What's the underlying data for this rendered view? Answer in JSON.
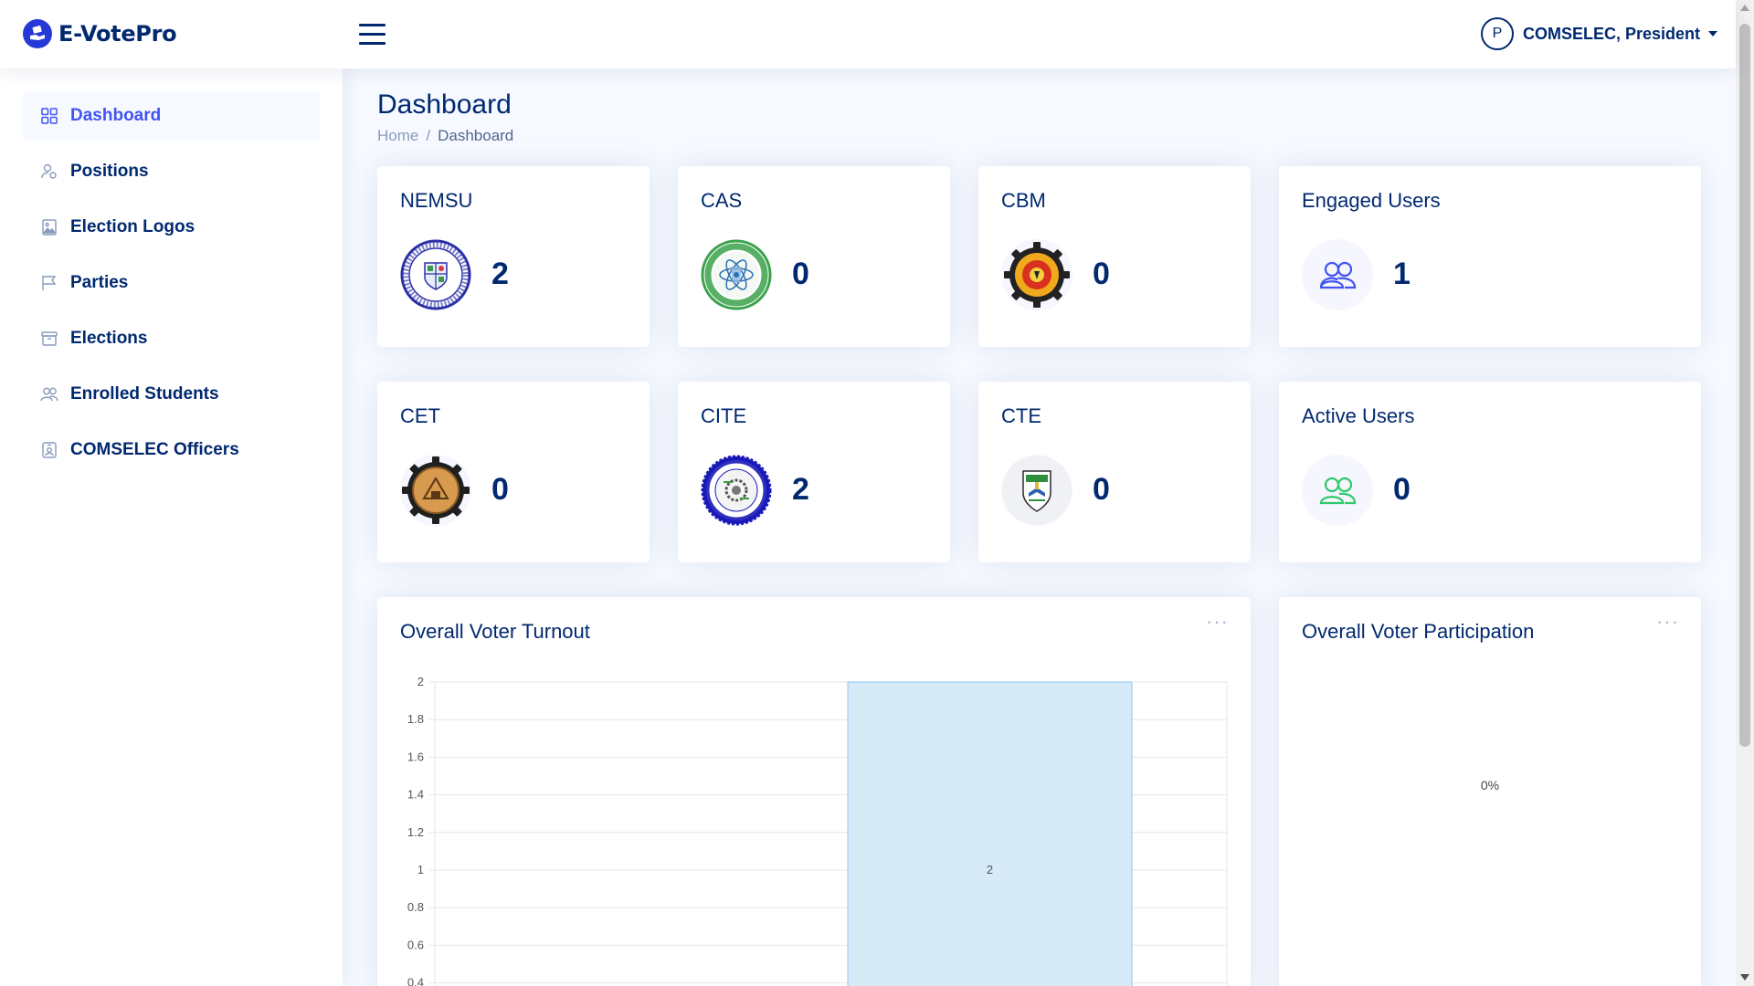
{
  "app": {
    "name": "E-VotePro"
  },
  "header": {
    "user_initial": "P",
    "user_name": "COMSELEC, President"
  },
  "sidebar": {
    "items": [
      {
        "label": "Dashboard",
        "icon": "grid-icon",
        "active": true
      },
      {
        "label": "Positions",
        "icon": "person-gear-icon"
      },
      {
        "label": "Election Logos",
        "icon": "image-icon"
      },
      {
        "label": "Parties",
        "icon": "flag-icon"
      },
      {
        "label": "Elections",
        "icon": "archive-icon"
      },
      {
        "label": "Enrolled Students",
        "icon": "people-icon"
      },
      {
        "label": "COMSELEC Officers",
        "icon": "person-badge-icon"
      }
    ]
  },
  "page": {
    "title": "Dashboard",
    "breadcrumb": [
      "Home",
      "Dashboard"
    ]
  },
  "stats": [
    {
      "title": "NEMSU",
      "value": "2",
      "icon": "nemsu-seal-icon"
    },
    {
      "title": "CAS",
      "value": "0",
      "icon": "cas-seal-icon"
    },
    {
      "title": "CBM",
      "value": "0",
      "icon": "cbm-seal-icon"
    },
    {
      "title": "Engaged Users",
      "value": "1",
      "icon": "people-icon"
    },
    {
      "title": "CET",
      "value": "0",
      "icon": "cet-seal-icon"
    },
    {
      "title": "CITE",
      "value": "2",
      "icon": "cite-seal-icon"
    },
    {
      "title": "CTE",
      "value": "0",
      "icon": "cte-seal-icon"
    },
    {
      "title": "Active Users",
      "value": "0",
      "icon": "people-icon"
    }
  ],
  "colors": {
    "primary": "#4154f1",
    "navy": "#012970",
    "bar_fill": "#d6eaf8",
    "bar_stroke": "#90c7f0",
    "active_users_icon": "#2eca6a"
  },
  "turnout": {
    "title": "Overall Voter Turnout",
    "menu": "···"
  },
  "participation": {
    "title": "Overall Voter Participation",
    "menu": "···",
    "center_label": "0%"
  },
  "chart_data": {
    "type": "bar",
    "title": "Overall Voter Turnout",
    "categories": [
      ""
    ],
    "values": [
      2
    ],
    "data_labels": [
      "2"
    ],
    "ylim": [
      0.4,
      2
    ],
    "yticks": [
      "2",
      "1.8",
      "1.6",
      "1.4",
      "1.2",
      "1",
      "0.8",
      "0.6",
      "0.4"
    ],
    "grid": true
  }
}
